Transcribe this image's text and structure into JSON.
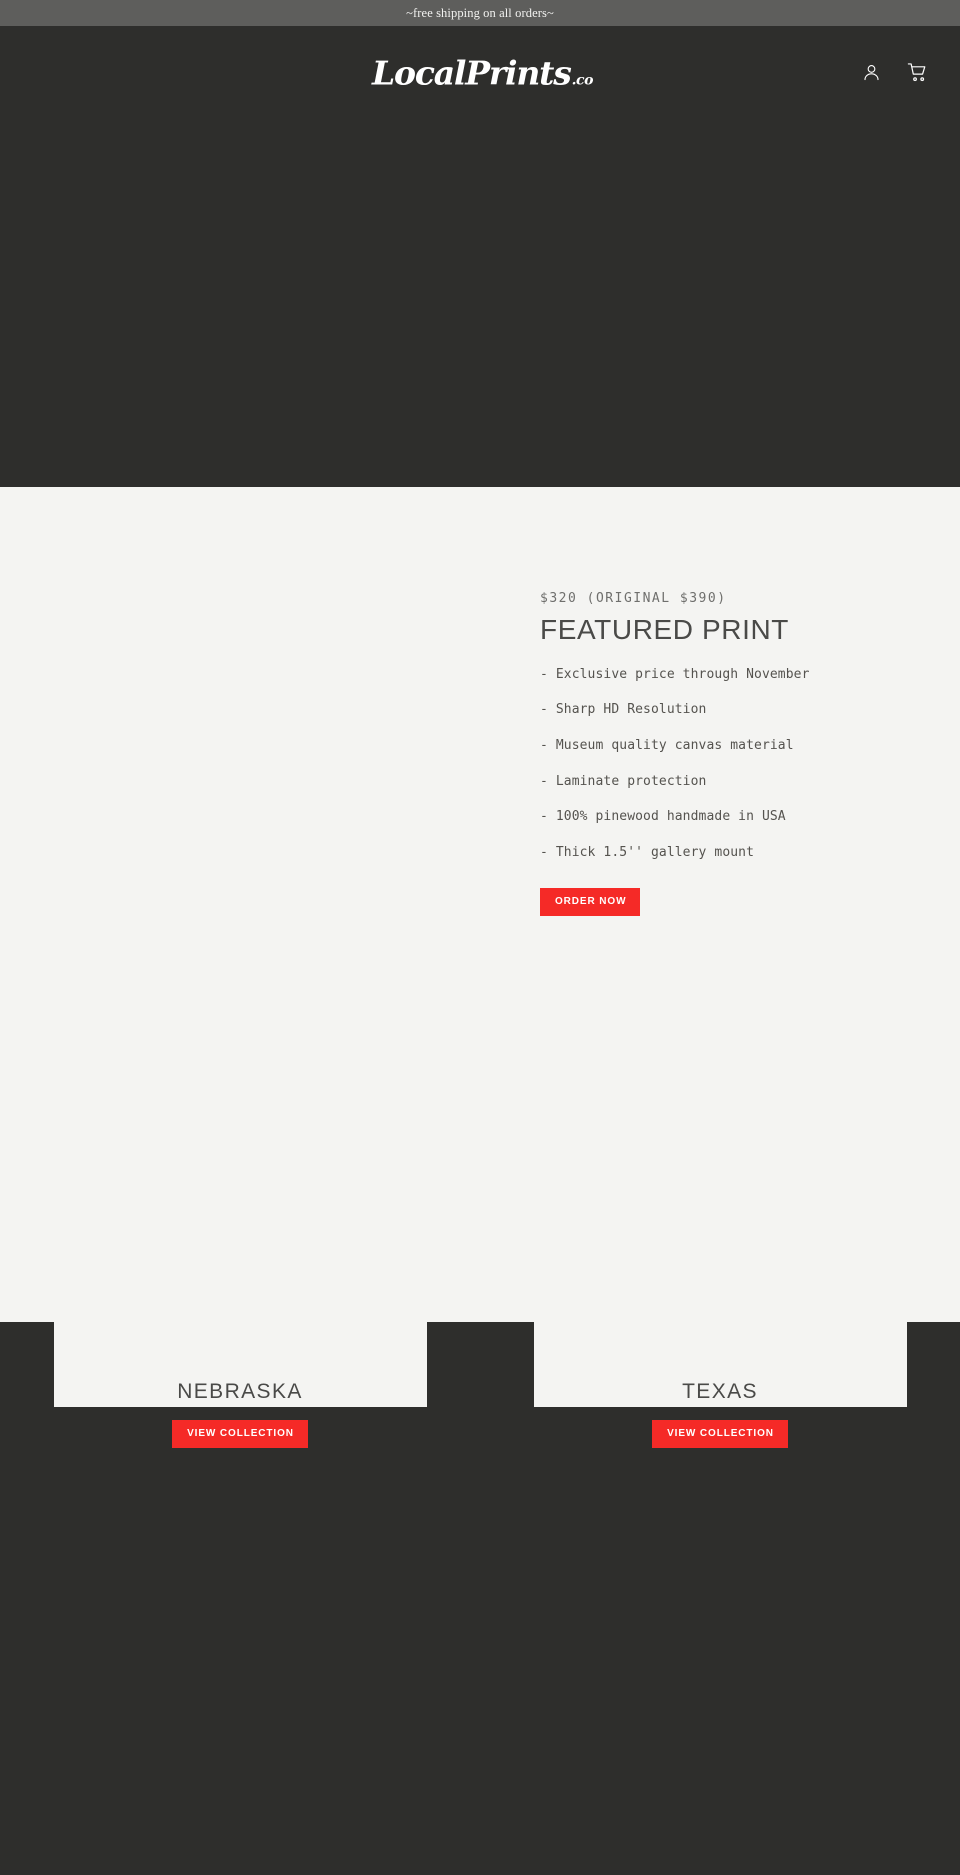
{
  "announcement": {
    "text": "~free shipping on all orders~",
    "background": "#5e5e5c"
  },
  "header": {
    "logo_main": "LocalPrints",
    "logo_suffix": ".co",
    "account_icon": "person-icon",
    "cart_icon": "shopping-cart-icon",
    "background": "#2e2e2c"
  },
  "featured": {
    "price_line": "$320 (ORIGINAL $390)",
    "title": "FEATURED PRINT",
    "features": [
      "- Exclusive price through November",
      "- Sharp HD Resolution",
      "- Museum quality canvas material",
      "- Laminate protection",
      "- 100% pinewood handmade in USA",
      "- Thick 1.5'' gallery mount"
    ],
    "order_label": "ORDER NOW"
  },
  "collections": [
    {
      "title": "NEBRASKA",
      "button_label": "VIEW COLLECTION"
    },
    {
      "title": "TEXAS",
      "button_label": "VIEW COLLECTION"
    }
  ],
  "colors": {
    "accent_red": "#f52a27",
    "dark": "#2e2e2c",
    "light": "#f4f4f2",
    "announcement_gray": "#5e5e5c"
  }
}
